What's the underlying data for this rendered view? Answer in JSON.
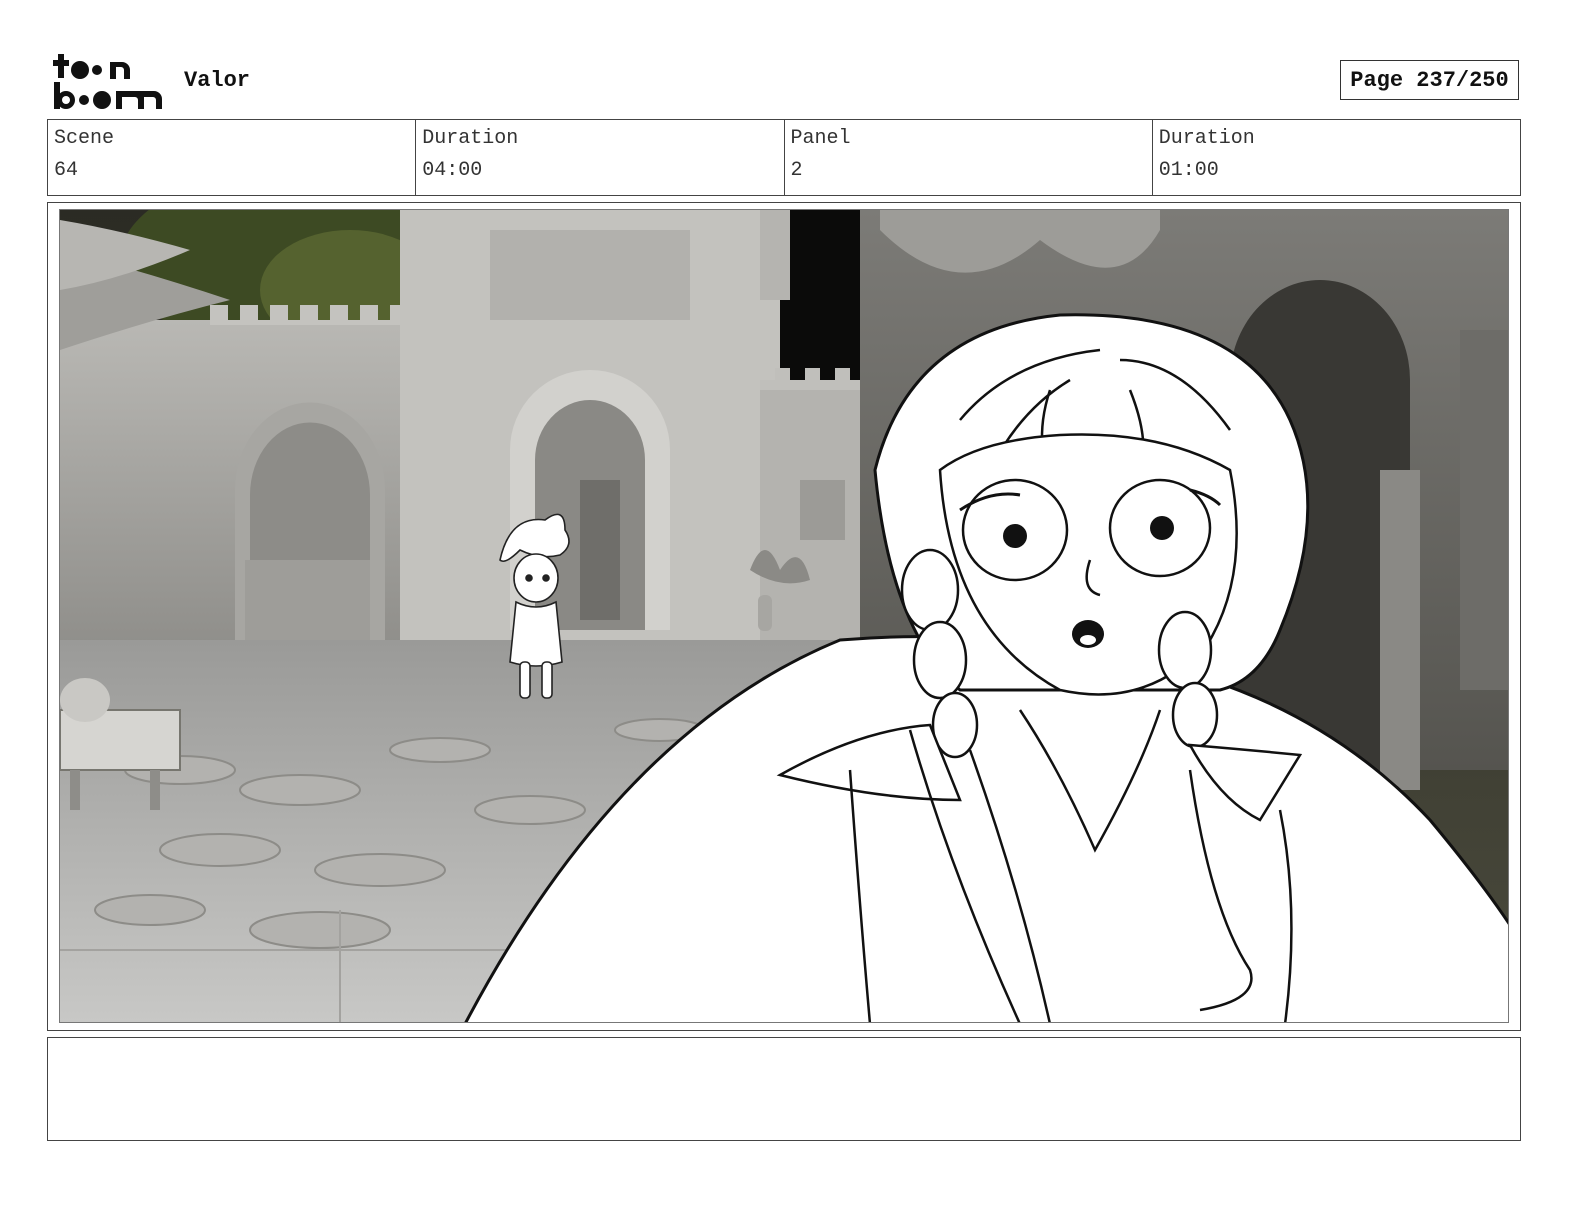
{
  "header": {
    "logo_line1": "toon",
    "logo_line2": "boom",
    "project_title": "Valor",
    "page_label": "Page 237/250"
  },
  "info": {
    "scene_label": "Scene",
    "scene_value": "64",
    "scene_duration_label": "Duration",
    "scene_duration_value": "04:00",
    "panel_label": "Panel",
    "panel_value": "2",
    "panel_duration_label": "Duration",
    "panel_duration_value": "01:00"
  },
  "notes": {
    "text": ""
  }
}
